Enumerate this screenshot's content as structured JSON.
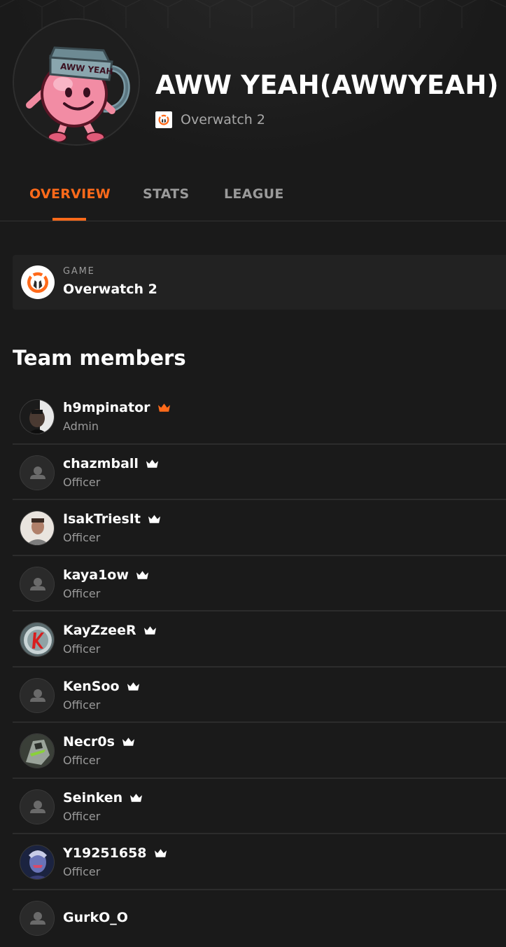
{
  "team": {
    "name": "AWW YEAH(AWWYEAH)",
    "game": "Overwatch 2",
    "logo_text": "AWW YEAH"
  },
  "tabs": [
    {
      "label": "OVERVIEW",
      "active": true
    },
    {
      "label": "STATS",
      "active": false
    },
    {
      "label": "LEAGUE",
      "active": false
    }
  ],
  "game_card": {
    "label": "GAME",
    "value": "Overwatch 2"
  },
  "members_title": "Team members",
  "members": [
    {
      "name": "h9mpinator",
      "role": "Admin",
      "crown": "orange",
      "avatar": "photo-dark"
    },
    {
      "name": "chazmball",
      "role": "Officer",
      "crown": "white",
      "avatar": "default"
    },
    {
      "name": "IsakTriesIt",
      "role": "Officer",
      "crown": "white",
      "avatar": "photo-light"
    },
    {
      "name": "kaya1ow",
      "role": "Officer",
      "crown": "white",
      "avatar": "default"
    },
    {
      "name": "KayZzeeR",
      "role": "Officer",
      "crown": "white",
      "avatar": "k-logo"
    },
    {
      "name": "KenSoo",
      "role": "Officer",
      "crown": "white",
      "avatar": "default"
    },
    {
      "name": "Necr0s",
      "role": "Officer",
      "crown": "white",
      "avatar": "genji"
    },
    {
      "name": "Seinken",
      "role": "Officer",
      "crown": "white",
      "avatar": "default"
    },
    {
      "name": "Y19251658",
      "role": "Officer",
      "crown": "white",
      "avatar": "purple-hero"
    },
    {
      "name": "GurkO_O",
      "role": "",
      "crown": "",
      "avatar": "default"
    }
  ],
  "colors": {
    "accent": "#ff6a1a",
    "background": "#1a1a1a",
    "card": "#222222",
    "muted": "#9a9a9a"
  }
}
